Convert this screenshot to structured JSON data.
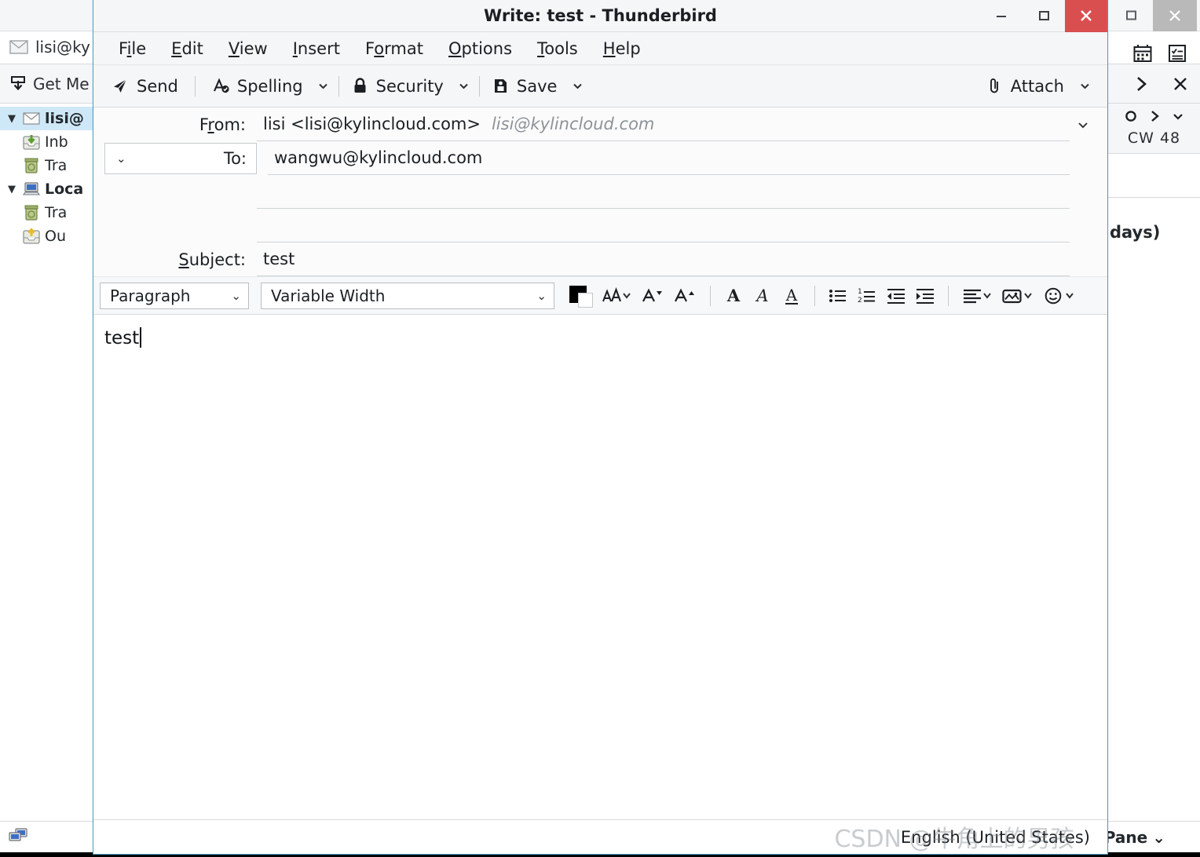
{
  "background_window": {
    "window_controls": {
      "maximize": "□",
      "close": "✕"
    },
    "tab": {
      "label": "lisi@ky",
      "icon": "envelope-icon"
    },
    "tab_icons": [
      {
        "name": "calendar-icon",
        "label": "Calendar"
      },
      {
        "name": "tasks-icon",
        "label": "Tasks"
      }
    ],
    "toolbar": {
      "get_messages_label": "Get Me",
      "icon": "get-messages-icon"
    },
    "nav": {
      "forward": "›",
      "close": "✕"
    },
    "folder_pane": [
      {
        "label": "lisi@",
        "icon": "account-mail-icon",
        "twisty": "▼",
        "bold": true,
        "selected": true,
        "indent": 0
      },
      {
        "label": "Inb",
        "icon": "inbox-icon",
        "twisty": "",
        "bold": false,
        "selected": false,
        "indent": 1
      },
      {
        "label": "Tra",
        "icon": "trash-icon",
        "twisty": "",
        "bold": false,
        "selected": false,
        "indent": 1
      },
      {
        "label": "Loca",
        "icon": "local-folders-icon",
        "twisty": "▼",
        "bold": true,
        "selected": false,
        "indent": 0
      },
      {
        "label": "Tra",
        "icon": "trash-icon",
        "twisty": "",
        "bold": false,
        "selected": false,
        "indent": 1
      },
      {
        "label": "Ou",
        "icon": "outbox-icon",
        "twisty": "",
        "bold": false,
        "selected": false,
        "indent": 1
      }
    ],
    "right_pane": {
      "today_icon": "today-circle-icon",
      "next_icon": "chevron-right-icon",
      "dropdown_icon": "chevron-down-icon",
      "calendar_week_label": "CW 48",
      "days_label": "days)"
    },
    "status_bar": {
      "network_icon": "network-status-icon",
      "pane_label": "Pane",
      "pane_caret": "⌄"
    }
  },
  "compose_window": {
    "title": "Write: test - Thunderbird",
    "window_controls": {
      "minimize": "—",
      "maximize": "□",
      "close": "✕"
    },
    "menus": [
      {
        "pre": "F",
        "key": "i",
        "post": "le"
      },
      {
        "pre": "",
        "key": "E",
        "post": "dit"
      },
      {
        "pre": "",
        "key": "V",
        "post": "iew"
      },
      {
        "pre": "",
        "key": "I",
        "post": "nsert"
      },
      {
        "pre": "F",
        "key": "o",
        "post": "rmat"
      },
      {
        "pre": "",
        "key": "O",
        "post": "ptions"
      },
      {
        "pre": "",
        "key": "T",
        "post": "ools"
      },
      {
        "pre": "",
        "key": "H",
        "post": "elp"
      }
    ],
    "toolbar": {
      "send_label": "Send",
      "send_icon": "send-paper-plane-icon",
      "spelling_label": "Spelling",
      "spelling_icon": "spell-check-icon",
      "security_label": "Security",
      "security_icon": "lock-icon",
      "save_label": "Save",
      "save_icon": "save-disk-icon",
      "attach_label": "Attach",
      "attach_icon": "paperclip-icon",
      "caret": "⌄"
    },
    "headers": {
      "from_label_pre": "F",
      "from_label_key": "r",
      "from_label_post": "om:",
      "from_value": "lisi <lisi@kylincloud.com>",
      "from_identity": "lisi@kylincloud.com",
      "from_caret": "⌄",
      "to_pill_caret": "⌄",
      "to_label": "To:",
      "to_value": "wangwu@kylincloud.com",
      "subject_label_pre": "",
      "subject_label_key": "S",
      "subject_label_post": "ubject:",
      "subject_value": "test"
    },
    "format_toolbar": {
      "paragraph_style": "Paragraph",
      "font_family": "Variable Width",
      "select_caret": "⌄",
      "text_color_swatch": "#000000",
      "background_color_swatch": "#ffffff",
      "buttons": [
        {
          "name": "font-color-button",
          "label": "Text Color"
        },
        {
          "name": "font-size-menu-button",
          "label": "Font Size"
        },
        {
          "name": "decrease-font-size-button",
          "label": "Smaller"
        },
        {
          "name": "increase-font-size-button",
          "label": "Larger"
        },
        {
          "name": "bold-button",
          "label": "Bold"
        },
        {
          "name": "italic-button",
          "label": "Italic"
        },
        {
          "name": "underline-button",
          "label": "Underline"
        },
        {
          "name": "bullet-list-button",
          "label": "Bulleted List"
        },
        {
          "name": "numbered-list-button",
          "label": "Numbered List"
        },
        {
          "name": "outdent-button",
          "label": "Decrease Indent"
        },
        {
          "name": "indent-button",
          "label": "Increase Indent"
        },
        {
          "name": "align-menu-button",
          "label": "Align"
        },
        {
          "name": "insert-image-menu-button",
          "label": "Insert"
        },
        {
          "name": "emoji-menu-button",
          "label": "Emoticons"
        }
      ]
    },
    "message_body": {
      "text": "test"
    },
    "status_bar": {
      "language": "English (United States)"
    }
  },
  "watermark": {
    "text": "CSDN @牛角上的男孩"
  }
}
